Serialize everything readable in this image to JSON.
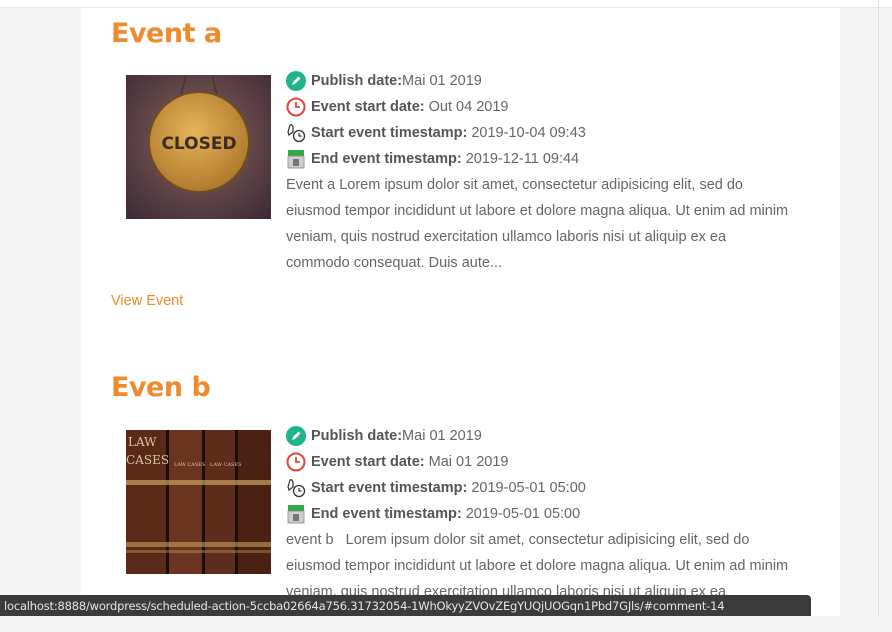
{
  "events": [
    {
      "title": "Event a",
      "image_alt": "CLOSED",
      "publish_label": "Publish date:",
      "publish_value": "Mai 01 2019",
      "start_label": "Event start date:",
      "start_value": "Out 04 2019",
      "start_ts_label": "Start event timestamp:",
      "start_ts_value": "2019-10-04 09:43",
      "end_ts_label": "End event timestamp:",
      "end_ts_value": "2019-12-11 09:44",
      "excerpt_lines": [
        "Event a Lorem ipsum dolor sit amet, consectetur adipisicing elit, sed do",
        "eiusmod tempor incididunt ut labore et dolore magna aliqua. Ut enim ad minim",
        "veniam, quis nostrud exercitation ullamco laboris nisi ut aliquip ex ea",
        "commodo consequat. Duis aute..."
      ],
      "view_label": "View Event"
    },
    {
      "title": "Even b",
      "image_text": [
        "LAW",
        "CASES",
        "LAW CASES"
      ],
      "publish_label": "Publish date:",
      "publish_value": "Mai 01 2019",
      "start_label": "Event start date:",
      "start_value": "Mai 01 2019",
      "start_ts_label": "Start event timestamp:",
      "start_ts_value": "2019-05-01 05:00",
      "end_ts_label": "End event timestamp:",
      "end_ts_value": "2019-05-01 05:00",
      "excerpt_lines": [
        "event b   Lorem ipsum dolor sit amet, consectetur adipisicing elit, sed do",
        "eiusmod tempor incididunt ut labore et dolore magna aliqua. Ut enim ad minim",
        "veniam, quis nostrud exercitation ullamco laboris nisi ut aliquip ex ea"
      ]
    }
  ],
  "icons": {
    "publish": "pencil-circle-icon",
    "start": "clock-icon",
    "start_ts": "stopwatch-hand-icon",
    "end_ts": "finish-calendar-icon"
  },
  "colors": {
    "accent": "#f08a2c",
    "publish_icon": "#1fb48c",
    "clock_icon": "#e0453c",
    "statusbar": "#3b3b3b"
  },
  "status_url": "localhost:8888/wordpress/scheduled-action-5ccba02664a756.31732054-1WhOkyyZVOvZEgYUQjUOGqn1Pbd7GJls/#comment-14"
}
